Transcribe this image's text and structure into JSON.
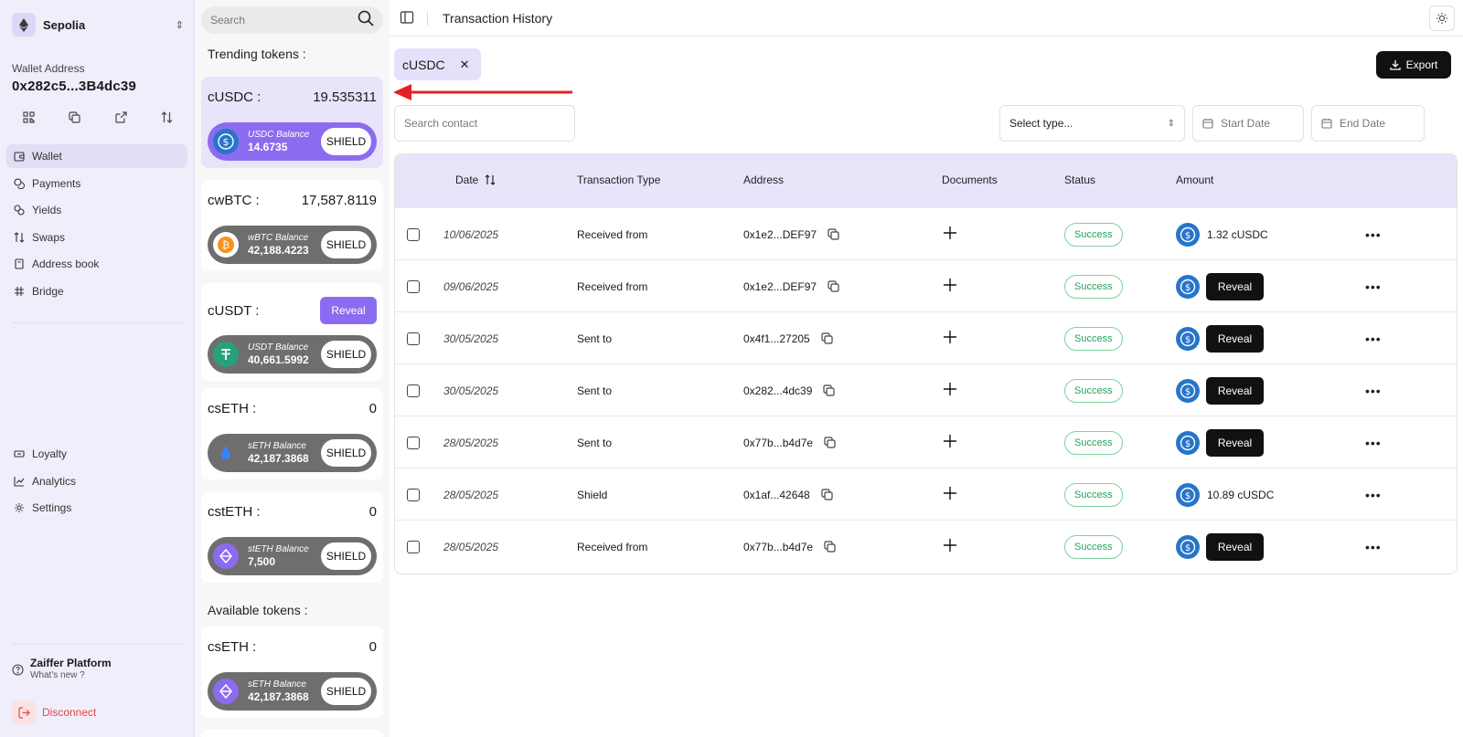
{
  "network": {
    "name": "Sepolia"
  },
  "wallet": {
    "label": "Wallet Address",
    "address": "0x282c5...3B4dc39"
  },
  "nav": {
    "wallet": "Wallet",
    "payments": "Payments",
    "yields": "Yields",
    "swaps": "Swaps",
    "address_book": "Address book",
    "bridge": "Bridge",
    "loyalty": "Loyalty",
    "analytics": "Analytics",
    "settings": "Settings"
  },
  "platform": {
    "title": "Zaiffer Platform",
    "subtitle": "What's new ?"
  },
  "disconnect": "Disconnect",
  "token_panel": {
    "search_placeholder": "Search",
    "trending_title": "Trending tokens :",
    "available_title": "Available tokens :",
    "shield_label": "SHIELD",
    "trending": [
      {
        "symbol": "cUSDC :",
        "amount": "19.535311",
        "balance_label": "USDC Balance",
        "balance": "14.6735",
        "icon": "usdc-icon"
      },
      {
        "symbol": "cwBTC :",
        "amount": "17,587.8119",
        "balance_label": "wBTC Balance",
        "balance": "42,188.4223",
        "icon": "btc-icon"
      },
      {
        "symbol": "cUSDT :",
        "reveal_label": "Reveal",
        "balance_label": "USDT Balance",
        "balance": "40,661.5992",
        "icon": "usdt-icon"
      },
      {
        "symbol": "csETH :",
        "amount": "0",
        "balance_label": "sETH Balance",
        "balance": "42,187.3868",
        "icon": "seth-icon"
      },
      {
        "symbol": "cstETH :",
        "amount": "0",
        "balance_label": "stETH Balance",
        "balance": "7,500",
        "icon": "steth-icon"
      }
    ],
    "available": [
      {
        "symbol": "csETH :",
        "amount": "0",
        "balance_label": "sETH Balance",
        "balance": "42,187.3868",
        "icon": "seth-icon"
      }
    ]
  },
  "header": {
    "title": "Transaction History"
  },
  "filter_chip": "cUSDC",
  "export_label": "Export",
  "search_contact_placeholder": "Search contact",
  "select_type": "Select type...",
  "start_date": "Start Date",
  "end_date": "End Date",
  "table": {
    "columns": [
      "Date",
      "Transaction Type",
      "Address",
      "Documents",
      "Status",
      "Amount"
    ],
    "rows": [
      {
        "date": "10/06/2025",
        "type": "Received from",
        "address": "0x1e2...DEF97",
        "status": "Success",
        "amount": "1.32 cUSDC"
      },
      {
        "date": "09/06/2025",
        "type": "Received from",
        "address": "0x1e2...DEF97",
        "status": "Success",
        "reveal": "Reveal"
      },
      {
        "date": "30/05/2025",
        "type": "Sent to",
        "address": "0x4f1...27205",
        "status": "Success",
        "reveal": "Reveal"
      },
      {
        "date": "30/05/2025",
        "type": "Sent to",
        "address": "0x282...4dc39",
        "status": "Success",
        "reveal": "Reveal"
      },
      {
        "date": "28/05/2025",
        "type": "Sent to",
        "address": "0x77b...b4d7e",
        "status": "Success",
        "reveal": "Reveal"
      },
      {
        "date": "28/05/2025",
        "type": "Shield",
        "address": "0x1af...42648",
        "status": "Success",
        "amount": "10.89 cUSDC"
      },
      {
        "date": "28/05/2025",
        "type": "Received from",
        "address": "0x77b...b4d7e",
        "status": "Success",
        "reveal": "Reveal"
      }
    ]
  },
  "colors": {
    "accent": "#8b6cf0",
    "usdc": "#2775ca",
    "success": "#22a35a",
    "danger": "#e04848",
    "annotation_arrow": "#e32222"
  }
}
